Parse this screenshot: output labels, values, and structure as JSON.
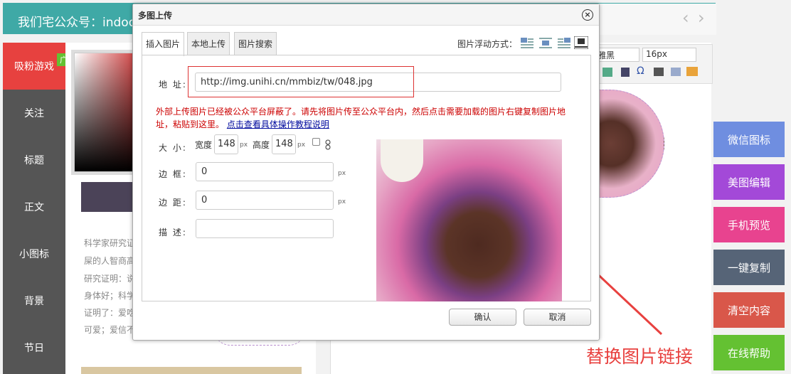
{
  "topbar": {
    "title": "我们宅公众号：indoor",
    "prev": "‹",
    "next": "›"
  },
  "leftnav": [
    "吸粉游戏",
    "关注",
    "标题",
    "正文",
    "小图标",
    "背景",
    "节日"
  ],
  "ad_badge": "广告",
  "middle_text": [
    "科学家研究证",
    "屎的人智商高",
    "研究证明：说",
    "身体好；科学",
    "证明了：爱吃",
    "可爱；爱信不"
  ],
  "toolbar": {
    "font": "软雅黑",
    "size": "16px"
  },
  "side_buttons": [
    {
      "label": "微信图标",
      "color": "#6f8ee0"
    },
    {
      "label": "美图编辑",
      "color": "#a349d8"
    },
    {
      "label": "手机预览",
      "color": "#e8438f"
    },
    {
      "label": "一键复制",
      "color": "#566477"
    },
    {
      "label": "清空内容",
      "color": "#d9574a"
    },
    {
      "label": "在线帮助",
      "color": "#64c132"
    }
  ],
  "annotation": "替换图片链接",
  "dialog": {
    "title": "多图上传",
    "close": "×",
    "tabs": [
      "插入图片",
      "本地上传",
      "图片搜索"
    ],
    "float_label": "图片浮动方式：",
    "address_label": "地 址:",
    "address_value": "http://img.unihi.cn/mmbiz/tw/048.jpg",
    "warning": "外部上传图片已经被公众平台屏蔽了。请先将图片传至公众平台内，然后点击需要加载的图片右键复制图片地址，粘贴到这里。",
    "warning_link": "点击查看具体操作教程说明",
    "size_label": "大 小:",
    "width_label": "宽度",
    "width_value": "148",
    "height_label": "高度",
    "height_value": "148",
    "px": "px",
    "border_label": "边 框:",
    "border_value": "0",
    "margin_label": "边 距:",
    "margin_value": "0",
    "desc_label": "描 述:",
    "desc_value": "",
    "confirm": "确认",
    "cancel": "取消"
  }
}
